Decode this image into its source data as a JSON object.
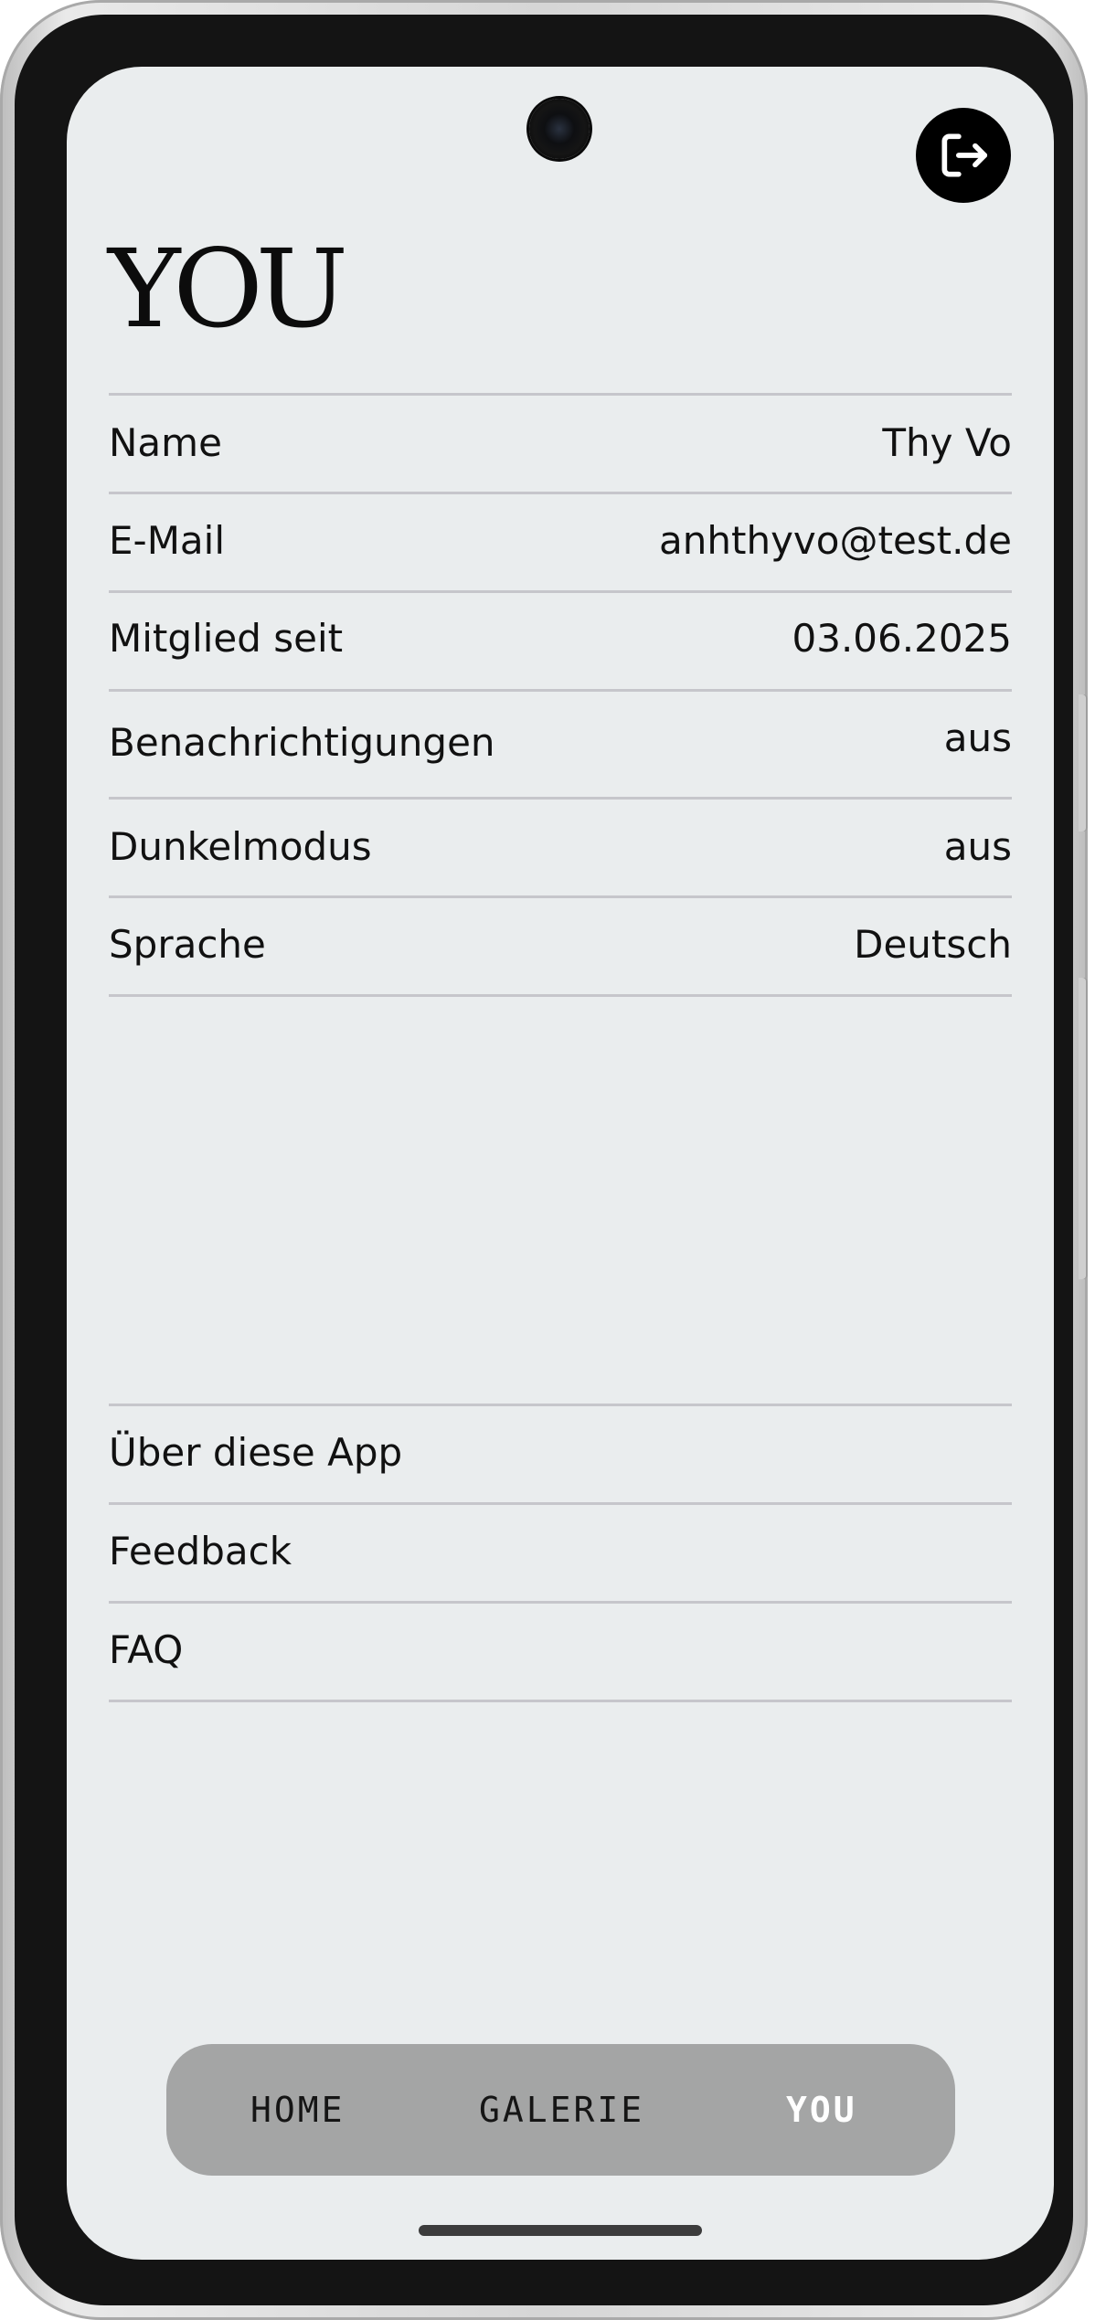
{
  "header": {
    "title": "YOU",
    "logout_icon": "logout-icon"
  },
  "settings": [
    {
      "label": "Name",
      "value": "Thy Vo"
    },
    {
      "label": "E-Mail",
      "value": "anhthyvo@test.de"
    },
    {
      "label": "Mitglied seit",
      "value": "03.06.2025"
    },
    {
      "label": "Benachrichtigungen",
      "value": "aus"
    },
    {
      "label": "Dunkelmodus",
      "value": "aus"
    },
    {
      "label": "Sprache",
      "value": "Deutsch"
    }
  ],
  "info_links": [
    {
      "label": "Über diese App"
    },
    {
      "label": "Feedback"
    },
    {
      "label": "FAQ"
    }
  ],
  "bottom_nav": {
    "tabs": [
      {
        "label": "HOME"
      },
      {
        "label": "GALERIE"
      },
      {
        "label": "YOU"
      }
    ],
    "active_tab": "YOU"
  },
  "colors": {
    "screen_background": "#eaedee",
    "divider": "#c6c6cb",
    "nav_background": "#a4a5a5",
    "active_tab": "#ffffff",
    "text": "#111111"
  }
}
